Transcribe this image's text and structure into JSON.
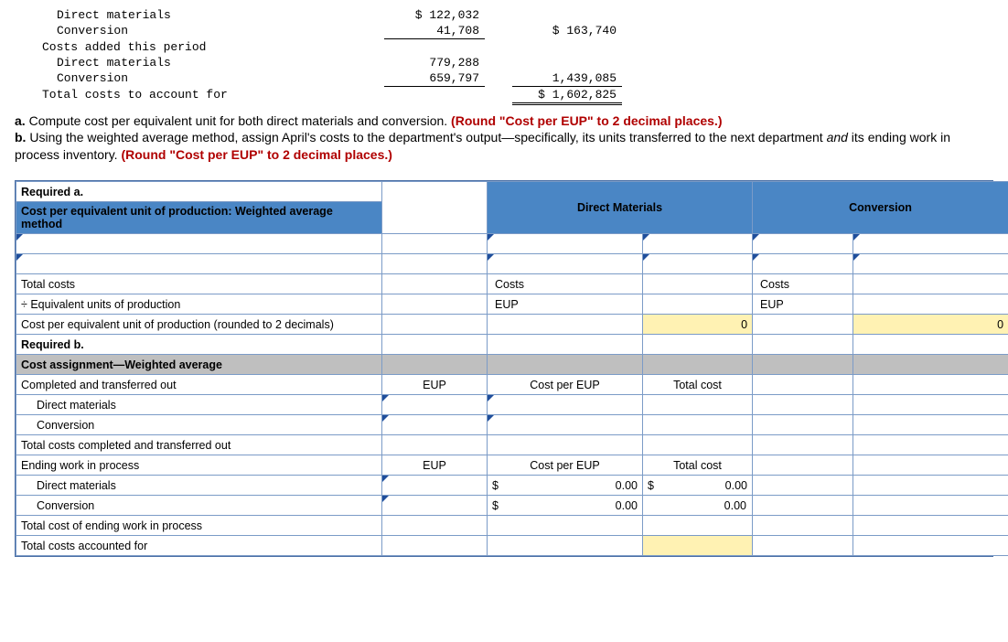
{
  "top": {
    "rows": {
      "dm_label": "Direct materials",
      "dm_amount": "$ 122,032",
      "conv_label": "Conversion",
      "conv_amount": "41,708",
      "conv_total": "$ 163,740",
      "added_label": "Costs added this period",
      "dm2_label": "Direct materials",
      "dm2_amount": "779,288",
      "conv2_label": "Conversion",
      "conv2_amount": "659,797",
      "added_total": "1,439,085",
      "grand_label": "Total costs to account for",
      "grand_total": "$ 1,602,825"
    }
  },
  "instr": {
    "a_prefix": "a.",
    "a_text": " Compute cost per equivalent unit for both direct materials and conversion. ",
    "a_red": "(Round \"Cost per EUP\" to 2 decimal places.)",
    "b_prefix": "b.",
    "b_text": " Using the weighted average method, assign April's costs to the department's output—specifically, its units transferred to the next department ",
    "b_italic": "and",
    "b_text2": " its ending work in process inventory. ",
    "b_red": "(Round \"Cost per EUP\" to 2 decimal places.)"
  },
  "ws": {
    "req_a": "Required a.",
    "title_a": "Cost per equivalent unit of production: Weighted average method",
    "dm_hdr": "Direct Materials",
    "conv_hdr": "Conversion",
    "total_costs": "Total costs",
    "costs_lbl": "Costs",
    "eup_label": "÷ Equivalent units of production",
    "eup_lbl": "EUP",
    "cpeup_label": "Cost per equivalent unit of production (rounded to 2 decimals)",
    "zero": "0",
    "req_b": "Required b.",
    "title_b": "Cost assignment—Weighted average",
    "row_cto": "Completed and transferred out",
    "eup_col": "EUP",
    "cpe_col": "Cost per EUP",
    "tc_col": "Total cost",
    "row_dm": "Direct materials",
    "row_conv": "Conversion",
    "row_totcto": "Total costs completed and transferred out",
    "row_ewip": "Ending work in process",
    "money_sym": "$",
    "money_val": "0.00",
    "row_totewip": "Total cost of ending work in process",
    "row_tcaf": "Total costs accounted for"
  }
}
